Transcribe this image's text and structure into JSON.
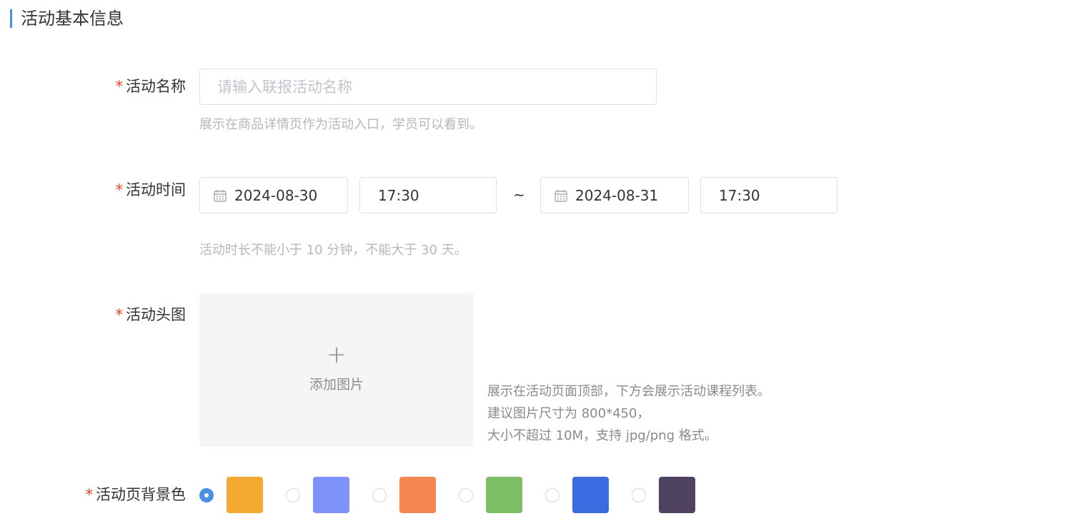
{
  "section": {
    "title": "活动基本信息"
  },
  "required_mark": "*",
  "name_field": {
    "label": "活动名称",
    "placeholder": "请输入联报活动名称",
    "hint": "展示在商品详情页作为活动入口，学员可以看到。"
  },
  "time_field": {
    "label": "活动时间",
    "start_date": "2024-08-30",
    "start_time": "17:30",
    "separator": "~",
    "end_date": "2024-08-31",
    "end_time": "17:30",
    "hint": "活动时长不能小于 10 分钟，不能大于 30 天。"
  },
  "header_image_field": {
    "label": "活动头图",
    "plus": "+",
    "upload_label": "添加图片",
    "description": [
      "展示在活动页面顶部，下方会展示活动课程列表。",
      "建议图片尺寸为 800*450，",
      "大小不超过 10M，支持 jpg/png 格式。"
    ]
  },
  "bg_color_field": {
    "label": "活动页背景色",
    "selected_index": 0,
    "options": [
      {
        "color": "#f4aa30"
      },
      {
        "color": "#7f91fb"
      },
      {
        "color": "#f58552"
      },
      {
        "color": "#7cbf62"
      },
      {
        "color": "#3a6be1"
      },
      {
        "color": "#4f4263"
      }
    ]
  },
  "colors": {
    "accent": "#4a90e2",
    "required": "#e6431c"
  }
}
